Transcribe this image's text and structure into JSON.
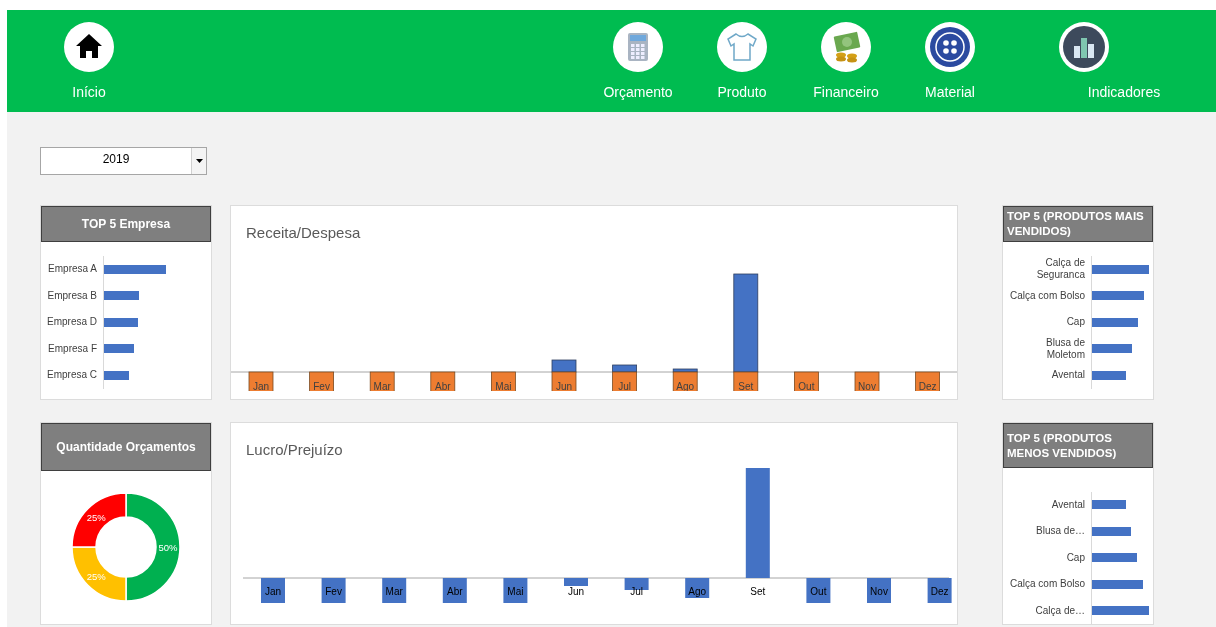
{
  "nav": {
    "items": [
      {
        "label": "Início",
        "kind": "home"
      },
      {
        "label": "Orçamento",
        "kind": "calculator"
      },
      {
        "label": "Produto",
        "kind": "shirt"
      },
      {
        "label": "Financeiro",
        "kind": "money"
      },
      {
        "label": "Material",
        "kind": "button"
      },
      {
        "label": "Indicadores",
        "kind": "chart"
      }
    ]
  },
  "year_select": {
    "value": "2019"
  },
  "top_empresas": {
    "title": "TOP 5 Empresa",
    "items": [
      "Empresa A",
      "Empresa B",
      "Empresa D",
      "Empresa F",
      "Empresa C"
    ]
  },
  "receita_despesa": {
    "title": "Receita/Despesa",
    "months": [
      "Jan",
      "Fev",
      "Mar",
      "Abr",
      "Mai",
      "Jun",
      "Jul",
      "Ago",
      "Set",
      "Out",
      "Nov",
      "Dez"
    ]
  },
  "produtos_mais_vendidos": {
    "title": "TOP 5 (PRODUTOS MAIS VENDIDOS)",
    "items": [
      "Calça de Seguranca",
      "Calça com Bolso",
      "Cap",
      "Blusa de Moletom",
      "Avental"
    ]
  },
  "quantidade_orcamentos": {
    "title": "Quantidade Orçamentos",
    "chart_data": {
      "type": "donut",
      "values": [
        50,
        25,
        25
      ],
      "value_labels": [
        "50%",
        "25%",
        "25%"
      ],
      "colors": [
        "#00b050",
        "#ffc000",
        "#ff0000"
      ]
    }
  },
  "lucro_prejuizo": {
    "title": "Lucro/Prejuízo",
    "months": [
      "Jan",
      "Fev",
      "Mar",
      "Abr",
      "Mai",
      "Jun",
      "Jul",
      "Ago",
      "Set",
      "Out",
      "Nov",
      "Dez"
    ]
  },
  "produtos_menos_vendidos": {
    "title": "TOP 5 (PRODUTOS MENOS VENDIDOS)",
    "items": [
      "Avental",
      "Blusa de…",
      "Cap",
      "Calça com Bolso",
      "Calça de…"
    ]
  }
}
